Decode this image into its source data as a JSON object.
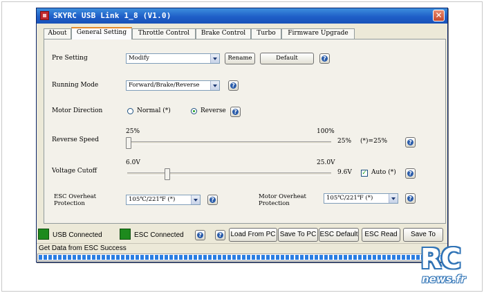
{
  "window": {
    "title": "SKYRC USB Link 1_8 (V1.0)"
  },
  "tabs": [
    {
      "label": "About"
    },
    {
      "label": "General Setting"
    },
    {
      "label": "Throttle Control"
    },
    {
      "label": "Brake Control"
    },
    {
      "label": "Turbo"
    },
    {
      "label": "Firmware Upgrade"
    }
  ],
  "active_tab": "General Setting",
  "settings": {
    "pre_setting": {
      "label": "Pre Setting",
      "value": "Modify",
      "rename_label": "Rename",
      "default_label": "Default"
    },
    "running_mode": {
      "label": "Running Mode",
      "value": "Forward/Brake/Reverse"
    },
    "motor_direction": {
      "label": "Motor Direction",
      "option_normal": "Normal (*)",
      "option_reverse": "Reverse",
      "selected": "Reverse"
    },
    "reverse_speed": {
      "label": "Reverse Speed",
      "min_label": "25%",
      "max_label": "100%",
      "value_label": "25%",
      "default_note": "(*)=25%",
      "level_fraction": 0.0
    },
    "voltage_cutoff": {
      "label": "Voltage Cutoff",
      "min_label": "6.0V",
      "max_label": "25.0V",
      "value_label": "9.6V",
      "auto_label": "Auto (*)",
      "auto_checked": true,
      "level_fraction": 0.19
    },
    "esc_overheat": {
      "label_line1": "ESC Overheat",
      "label_line2": "Protection",
      "value": "105℃/221℉ (*)"
    },
    "motor_overheat": {
      "label_line1": "Motor Overheat",
      "label_line2": "Protection",
      "value": "105℃/221℉ (*)"
    }
  },
  "help_glyph": "?",
  "bottom_bar": {
    "usb_status": "USB Connected",
    "esc_status": "ESC Connected",
    "load_from_pc": "Load From PC",
    "save_to_pc": "Save To PC",
    "esc_default": "ESC Default",
    "esc_read": "ESC Read",
    "save_to_esc": "Save To ESC",
    "led_color": "#1d8a1d"
  },
  "status_bar": {
    "text": "Get Data from ESC Success",
    "progress_fraction": 1.0
  },
  "watermark": {
    "brand": "RC",
    "site": "news.fr"
  }
}
